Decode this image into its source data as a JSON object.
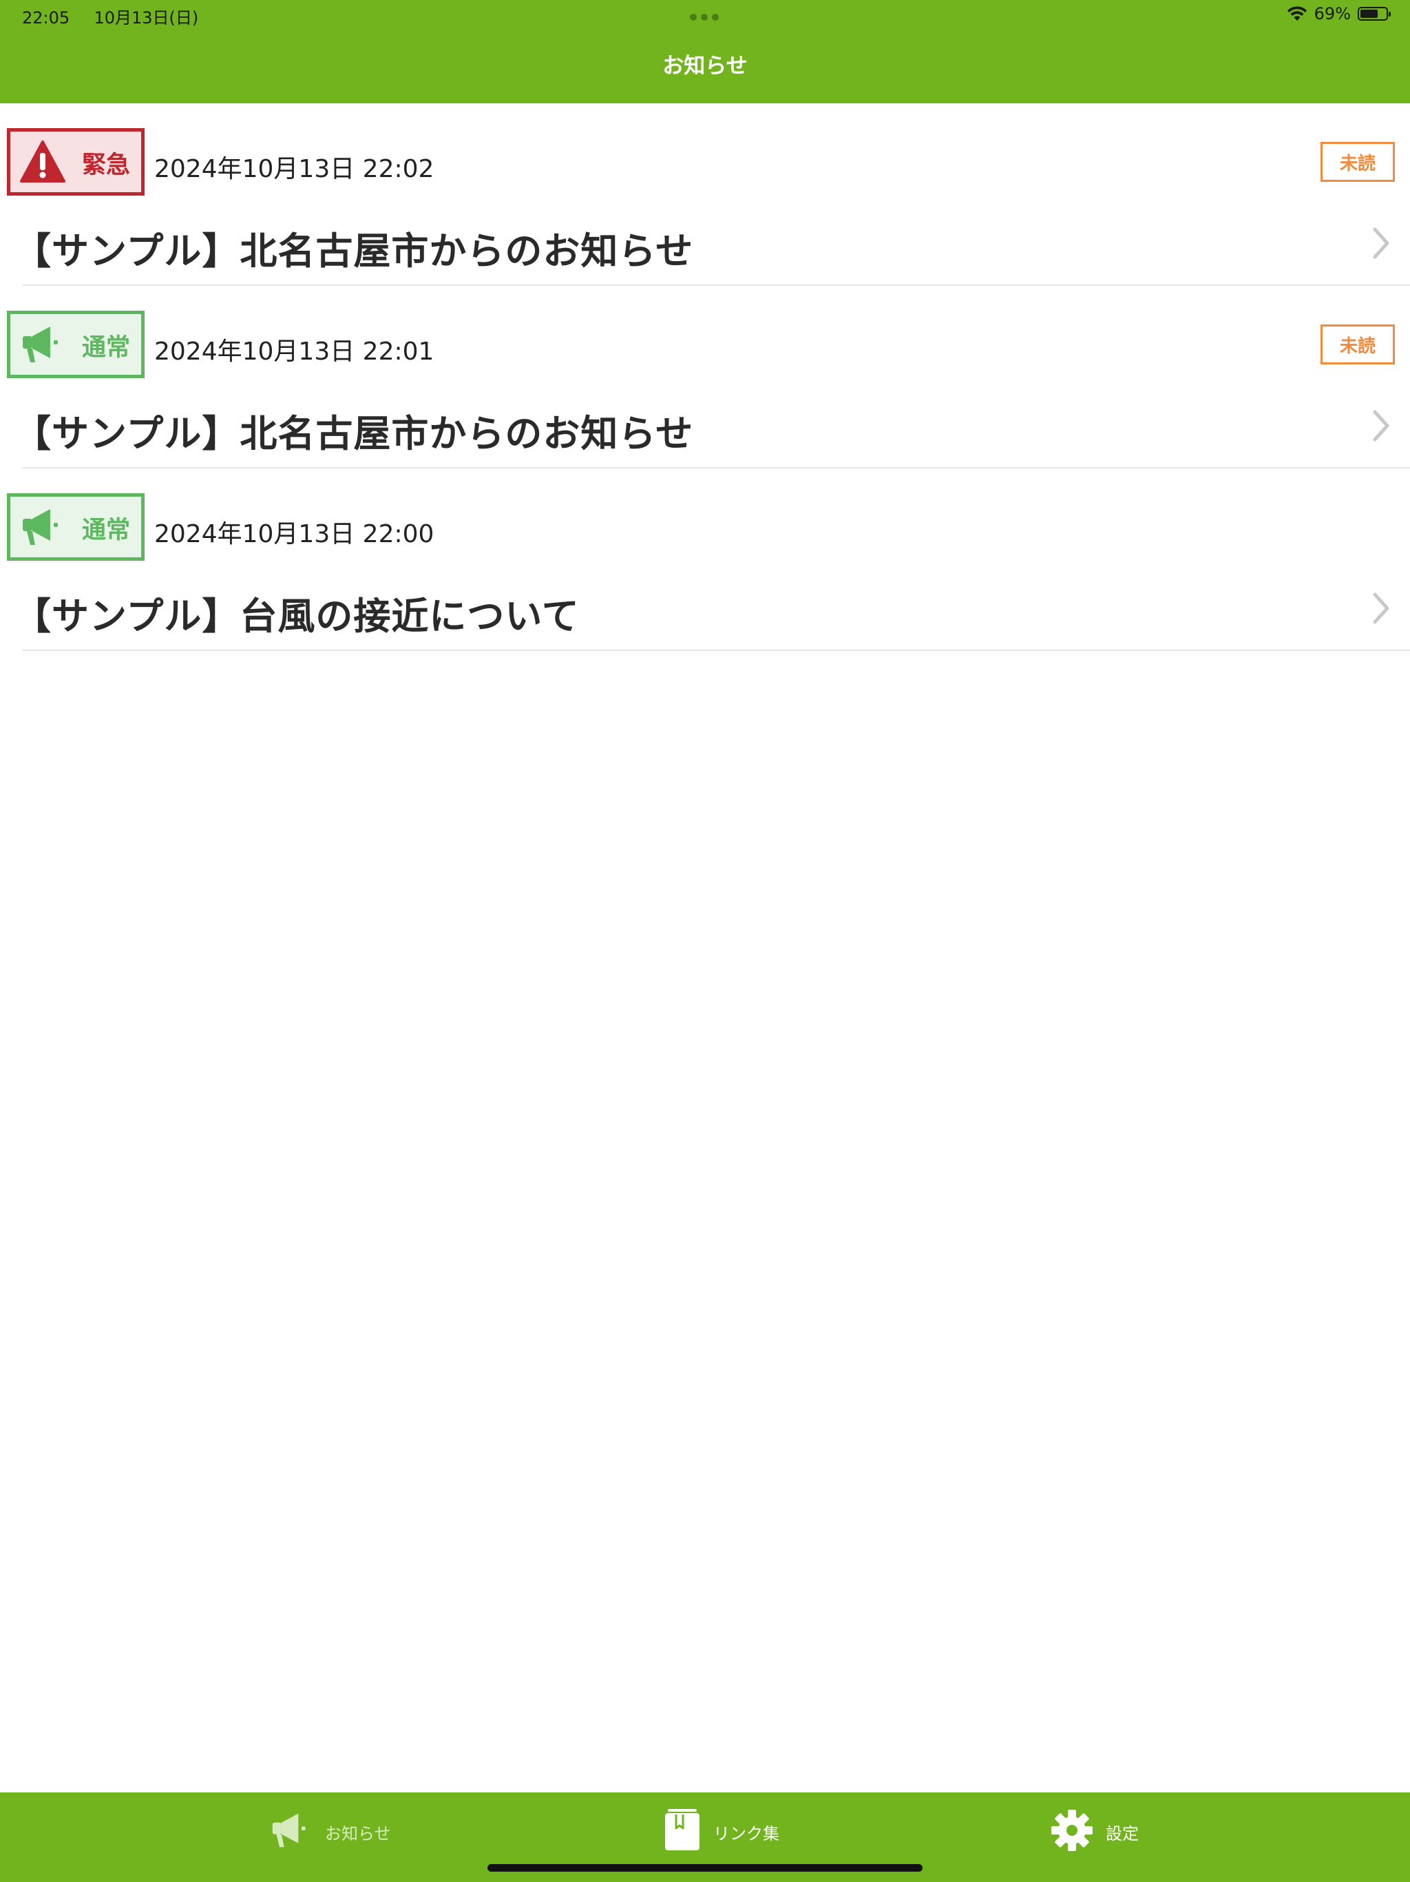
{
  "status_bar": {
    "time": "22:05",
    "date": "10月13日(日)",
    "battery": "69%",
    "battery_level": 0.69
  },
  "header": {
    "title": "お知らせ"
  },
  "colors": {
    "brand_green": "#72b41e",
    "emergency_red": "#c0262d",
    "emergency_bg": "#f8e1e2",
    "normal_green": "#5db85f",
    "normal_bg": "#e8f5e8",
    "unread_orange": "#f08a3c"
  },
  "notices": [
    {
      "type": "emergency",
      "badge_label": "緊急",
      "badge_icon": "warning-triangle-icon",
      "datetime": "2024年10月13日 22:02",
      "unread_label": "未読",
      "title": "【サンプル】北名古屋市からのお知らせ"
    },
    {
      "type": "normal",
      "badge_label": "通常",
      "badge_icon": "megaphone-icon",
      "datetime": "2024年10月13日 22:01",
      "unread_label": "未読",
      "title": "【サンプル】北名古屋市からのお知らせ"
    },
    {
      "type": "normal",
      "badge_label": "通常",
      "badge_icon": "megaphone-icon",
      "datetime": "2024年10月13日 22:00",
      "unread_label": "",
      "title": "【サンプル】台風の接近について"
    }
  ],
  "tabbar": {
    "items": [
      {
        "label": "お知らせ",
        "icon": "megaphone-icon",
        "selected": false
      },
      {
        "label": "リンク集",
        "icon": "bookmark-book-icon",
        "selected": true
      },
      {
        "label": "設定",
        "icon": "gear-icon",
        "selected": false
      }
    ]
  }
}
